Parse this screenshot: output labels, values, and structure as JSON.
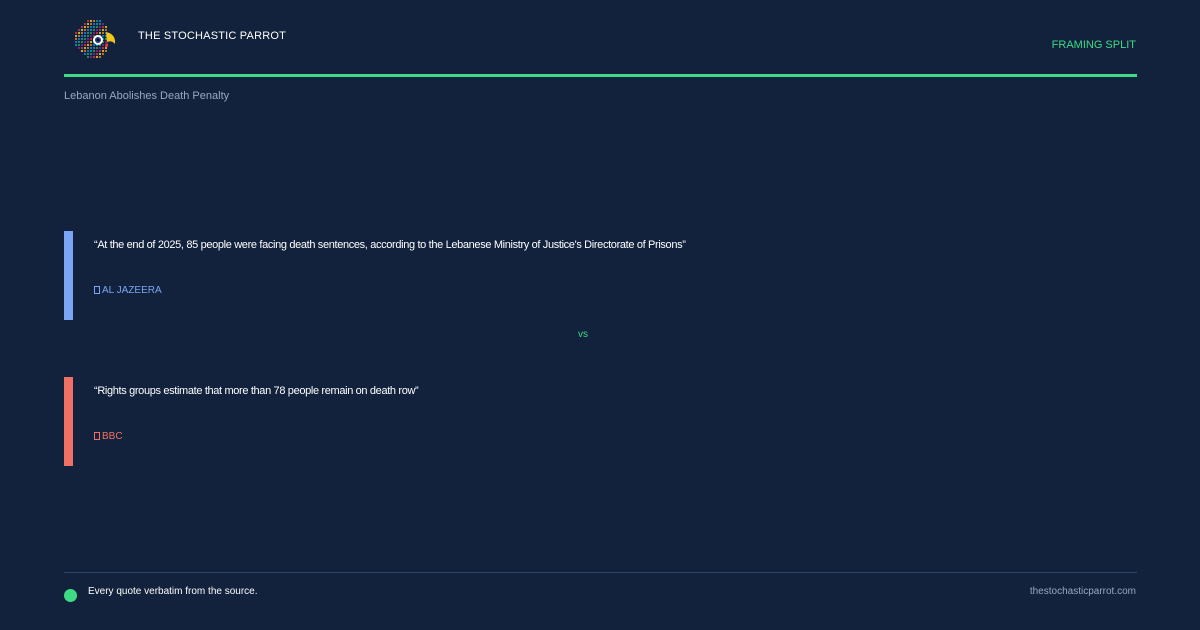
{
  "header": {
    "brand": "THE STOCHASTIC PARROT",
    "section_label": "FRAMING SPLIT",
    "logo_icon": "parrot-logo-icon",
    "accent_color": "#3ddc84"
  },
  "headline": "Lebanon Abolishes Death Penalty",
  "quotes": [
    {
      "text": "“At the end of 2025, 85 people were facing death sentences, according to the Lebanese Ministry of Justice's Directorate of Prisons”",
      "source": "AL JAZEERA",
      "color": "#7aa6f5"
    },
    {
      "text": "“Rights groups estimate that more than 78 people remain on death row”",
      "source": "BBC",
      "color": "#f07065"
    }
  ],
  "separator": "vs",
  "footer": {
    "note": "Every quote verbatim from the source.",
    "url": "thestochasticparrot.com"
  }
}
